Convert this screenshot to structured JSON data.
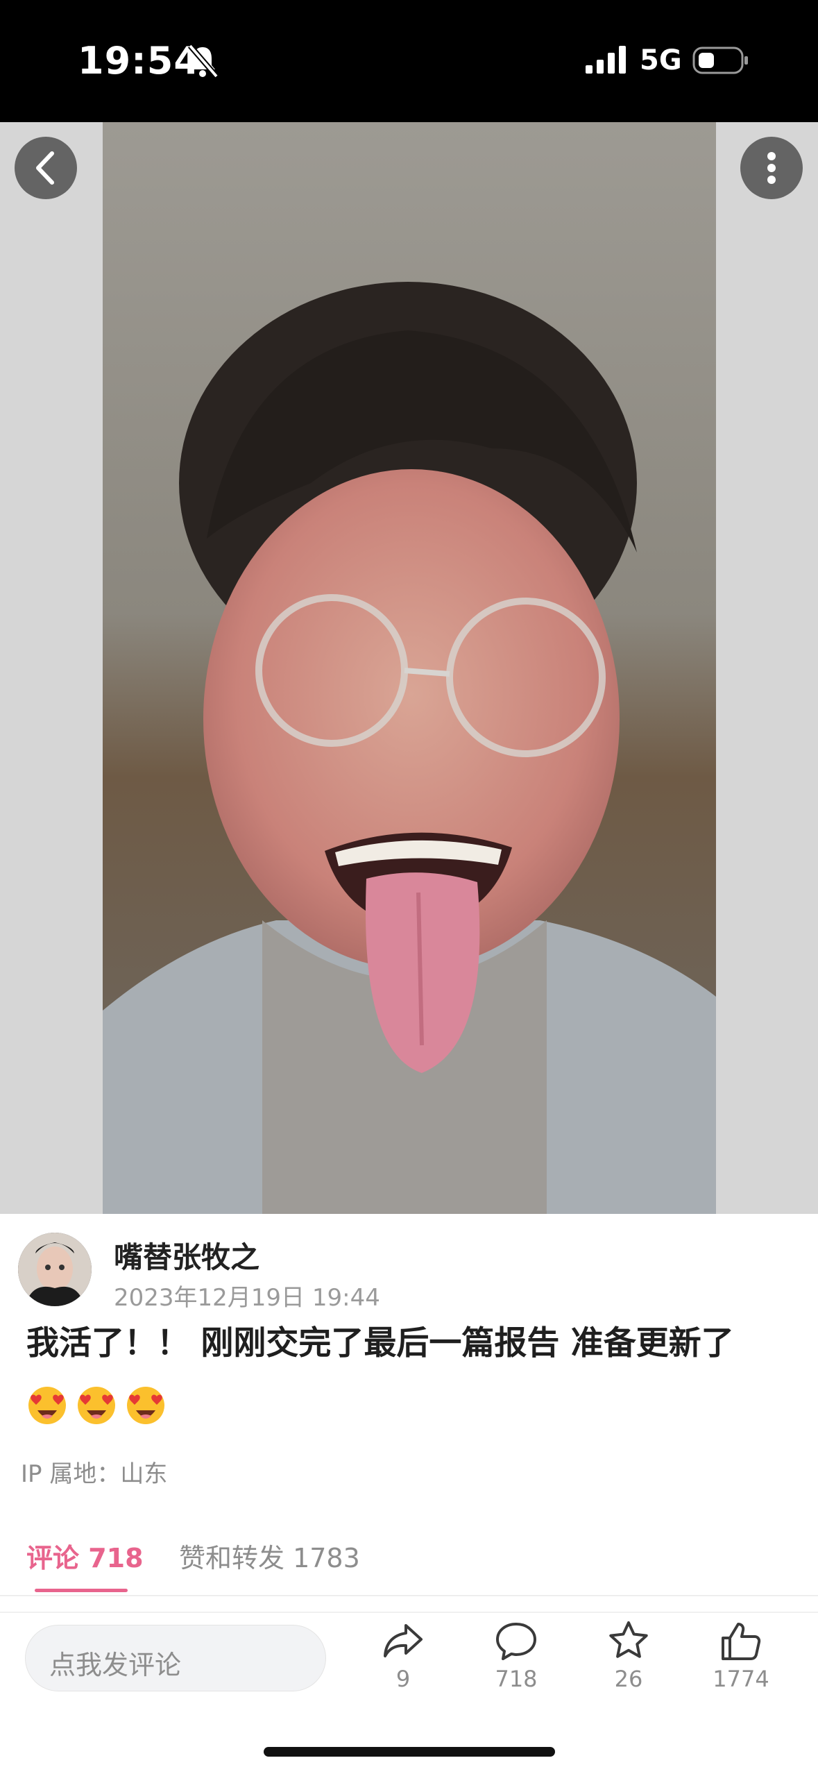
{
  "status_bar": {
    "time": "19:54",
    "network": "5G",
    "icons": [
      "bell-slash-icon",
      "signal-icon",
      "battery-icon"
    ]
  },
  "nav": {
    "back_icon": "chevron-left-icon",
    "more_icon": "more-vertical-icon"
  },
  "post": {
    "username": "嘴替张牧之",
    "date": "2023年12月19日 19:44",
    "content": "我活了！！ 刚刚交完了最后一篇报告 准备更新了",
    "emojis": [
      "heart-eyes-emoji",
      "heart-eyes-emoji",
      "heart-eyes-emoji"
    ],
    "ip_location": "IP 属地：山东"
  },
  "tabs": {
    "comments": "评论 718",
    "likes_reposts": "赞和转发 1783",
    "active_color": "#e8648d"
  },
  "action_bar": {
    "comment_placeholder": "点我发评论",
    "share_count": "9",
    "comment_count": "718",
    "favorite_count": "26",
    "like_count": "1774"
  }
}
